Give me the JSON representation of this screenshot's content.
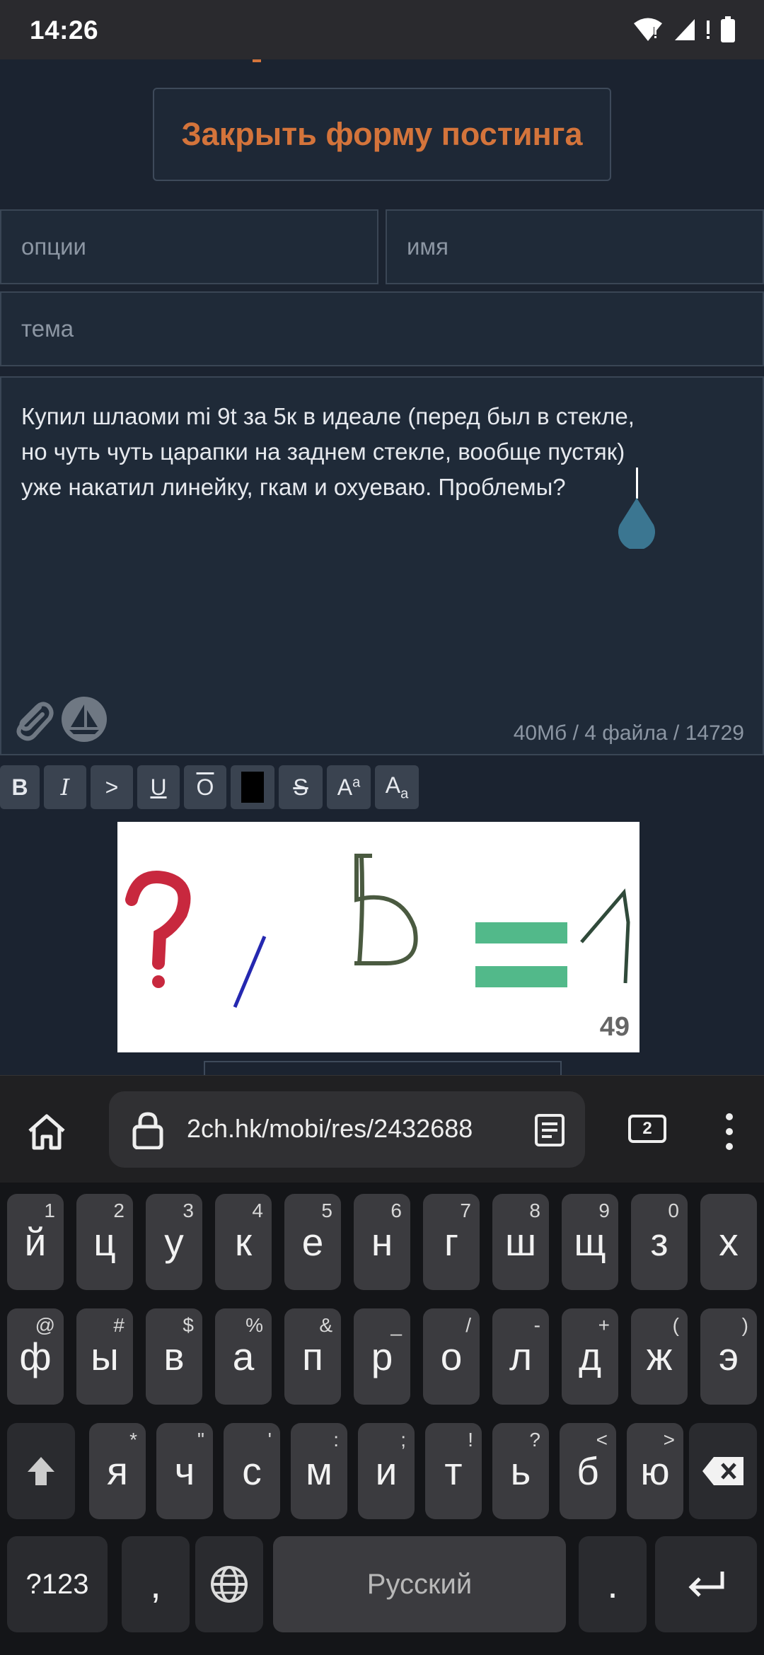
{
  "status_bar": {
    "time": "14:26"
  },
  "form": {
    "close_button_label": "Закрыть форму постинга",
    "options_placeholder": "опции",
    "name_placeholder": "имя",
    "subject_placeholder": "тема",
    "comment_text": "Купил шлаоми mi 9t за 5к в идеале (перед был в стекле,\nно чуть чуть царапки на заднем стекле, вообще пустяк)\nуже накатил линейку, гкам и охуеваю. Проблемы?",
    "limits": "40Мб / 4 файла / 14729"
  },
  "format_buttons": [
    "B",
    "I",
    ">",
    "U",
    "O",
    "",
    "S",
    "Aa",
    "Aa"
  ],
  "captcha": {
    "number": "49"
  },
  "browser": {
    "url": "2ch.hk/mobi/res/2432688",
    "tab_count": "2"
  },
  "keyboard": {
    "row1": [
      {
        "k": "й",
        "h": "1"
      },
      {
        "k": "ц",
        "h": "2"
      },
      {
        "k": "у",
        "h": "3"
      },
      {
        "k": "к",
        "h": "4"
      },
      {
        "k": "е",
        "h": "5"
      },
      {
        "k": "н",
        "h": "6"
      },
      {
        "k": "г",
        "h": "7"
      },
      {
        "k": "ш",
        "h": "8"
      },
      {
        "k": "щ",
        "h": "9"
      },
      {
        "k": "з",
        "h": "0"
      },
      {
        "k": "х",
        "h": ""
      }
    ],
    "row2": [
      {
        "k": "ф",
        "h": "@"
      },
      {
        "k": "ы",
        "h": "#"
      },
      {
        "k": "в",
        "h": "$"
      },
      {
        "k": "а",
        "h": "%"
      },
      {
        "k": "п",
        "h": "&"
      },
      {
        "k": "р",
        "h": "_"
      },
      {
        "k": "о",
        "h": "/"
      },
      {
        "k": "л",
        "h": "-"
      },
      {
        "k": "д",
        "h": "+"
      },
      {
        "k": "ж",
        "h": "("
      },
      {
        "k": "э",
        "h": ")"
      }
    ],
    "row3": [
      {
        "k": "я",
        "h": "*"
      },
      {
        "k": "ч",
        "h": "\""
      },
      {
        "k": "с",
        "h": "'"
      },
      {
        "k": "м",
        "h": ":"
      },
      {
        "k": "и",
        "h": ";"
      },
      {
        "k": "т",
        "h": "!"
      },
      {
        "k": "ь",
        "h": "?"
      },
      {
        "k": "б",
        "h": "<"
      },
      {
        "k": "ю",
        "h": ">"
      }
    ],
    "symbols_label": "?123",
    "comma_label": ",",
    "space_label": "Русский",
    "period_label": "."
  }
}
